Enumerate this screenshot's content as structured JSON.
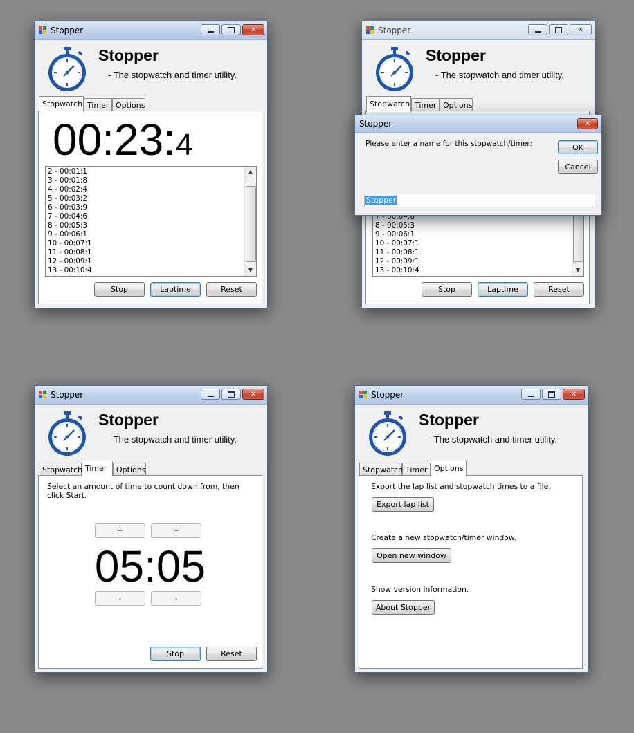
{
  "app": {
    "title": "Stopper",
    "name": "Stopper",
    "tagline": "- The stopwatch and timer utility."
  },
  "tabs": {
    "stopwatch": "Stopwatch",
    "timer": "Timer",
    "options": "Options"
  },
  "stopwatch": {
    "time_main": "00:23:",
    "time_tenths": "4",
    "laps_window1": [
      "2 - 00:01:1",
      "3 - 00:01:8",
      "4 - 00:02:4",
      "5 - 00:03:2",
      "6 - 00:03:9",
      "7 - 00:04:6",
      "8 - 00:05:3",
      "9 - 00:06:1",
      "10 - 00:07:1",
      "11 - 00:08:1",
      "12 - 00:09:1",
      "13 - 00:10:4"
    ],
    "laps_window2": [
      "7 - 00:04:6",
      "8 - 00:05:3",
      "9 - 00:06:1",
      "10 - 00:07:1",
      "11 - 00:08:1",
      "12 - 00:09:1",
      "13 - 00:10:4"
    ],
    "stop_label": "Stop",
    "laptime_label": "Laptime",
    "reset_label": "Reset"
  },
  "dialog": {
    "title": "Stopper",
    "message": "Please enter a name for this stopwatch/timer:",
    "ok_label": "OK",
    "cancel_label": "Cancel",
    "input_value": "Stopper"
  },
  "timer": {
    "instructions": "Select an amount of time to count down from, then click Start.",
    "plus_label": "+",
    "minus_label": "-",
    "display": "05:05",
    "stop_label": "Stop",
    "reset_label": "Reset"
  },
  "options": {
    "export_text": "Export the lap list and stopwatch times to a file.",
    "export_label": "Export lap list",
    "new_text": "Create a new stopwatch/timer window.",
    "new_label": "Open new window",
    "version_text": "Show version information.",
    "about_label": "About Stopper"
  },
  "colors": {
    "desktop": "#8a8a8a",
    "window_bg": "#f0f0f0",
    "stopwatch_icon": "#1f56a8",
    "close_button": "#c8432c"
  },
  "icons": [
    "app-icon",
    "stopwatch-icon",
    "minimize-icon",
    "maximize-icon",
    "close-icon"
  ]
}
